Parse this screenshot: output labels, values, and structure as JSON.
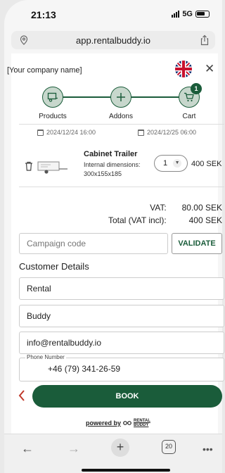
{
  "status_bar": {
    "time": "21:13",
    "network": "5G"
  },
  "browser": {
    "url": "app.rentalbuddy.io"
  },
  "header": {
    "company_name": "[Your company name]",
    "close_symbol": "✕"
  },
  "stepper": {
    "steps": [
      {
        "label": "Products",
        "icon": "trailer-icon"
      },
      {
        "label": "Addons",
        "icon": "plus-icon"
      },
      {
        "label": "Cart",
        "icon": "cart-icon",
        "badge": "1"
      }
    ]
  },
  "booking": {
    "start_date": "2024/12/24 16:00",
    "end_date": "2024/12/25 06:00"
  },
  "cart_item": {
    "title": "Cabinet Trailer",
    "dimensions_label": "Internal dimensions:",
    "dimensions_value": "300x155x185",
    "quantity": "1",
    "price": "400 SEK"
  },
  "totals": {
    "vat_label": "VAT:",
    "vat_value": "80.00 SEK",
    "total_label": "Total (VAT incl):",
    "total_value": "400 SEK"
  },
  "campaign": {
    "placeholder": "Campaign code",
    "validate_label": "VALIDATE"
  },
  "customer": {
    "section_title": "Customer Details",
    "first_name": "Rental",
    "last_name": "Buddy",
    "email": "info@rentalbuddy.io",
    "phone_label": "Phone Number",
    "phone_value": "+46 (79) 341-26-59"
  },
  "actions": {
    "book_label": "BOOK"
  },
  "footer": {
    "powered_by": "powered by",
    "brand_line1": "RENTAL",
    "brand_line2": "BUDDY"
  },
  "toolbar": {
    "tab_count": "20"
  },
  "colors": {
    "brand_green": "#1a5c3a",
    "step_fill": "#c7d7cc"
  }
}
